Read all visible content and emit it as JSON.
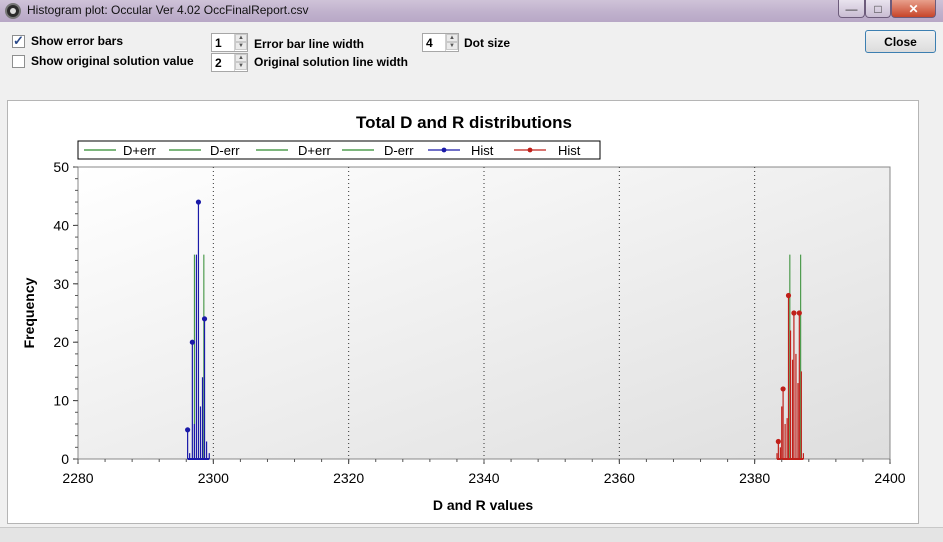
{
  "window": {
    "title": "Histogram plot: Occular Ver 4.02 OccFinalReport.csv",
    "min_glyph": "—",
    "max_glyph": "□",
    "close_glyph": "✕"
  },
  "controls": {
    "show_error_bars": {
      "label": "Show error bars",
      "checked": true
    },
    "show_original": {
      "label": "Show original solution value",
      "checked": false
    },
    "error_bar_line_width": {
      "label": "Error bar line width",
      "value": "1"
    },
    "original_solution_line_width": {
      "label": "Original solution line width",
      "value": "2"
    },
    "dot_size": {
      "label": "Dot size",
      "value": "4"
    },
    "close_label": "Close"
  },
  "chart_data": {
    "type": "line",
    "title": "Total D and R distributions",
    "xlabel": "D and R values",
    "ylabel": "Frequency",
    "xlim": [
      2280,
      2400
    ],
    "ylim": [
      0,
      50
    ],
    "xticks": [
      2280,
      2300,
      2320,
      2340,
      2360,
      2380,
      2400
    ],
    "yticks": [
      0,
      10,
      20,
      30,
      40,
      50
    ],
    "grid": "vertical dotted",
    "legend_position": "top",
    "legend": [
      {
        "label": "D+err",
        "color": "#2e8b2e",
        "marker": false
      },
      {
        "label": "D-err",
        "color": "#2e8b2e",
        "marker": false
      },
      {
        "label": "D+err",
        "color": "#2e8b2e",
        "marker": false
      },
      {
        "label": "D-err",
        "color": "#2e8b2e",
        "marker": false
      },
      {
        "label": "Hist",
        "color": "#1a1aa8",
        "marker": true
      },
      {
        "label": "Hist",
        "color": "#c0201a",
        "marker": true
      }
    ],
    "error_lines": [
      {
        "name": "D+err",
        "x": 2297.2,
        "y": 35,
        "color": "#2e8b2e"
      },
      {
        "name": "D-err",
        "x": 2298.6,
        "y": 35,
        "color": "#2e8b2e"
      },
      {
        "name": "D+err",
        "x": 2385.2,
        "y": 35,
        "color": "#2e8b2e"
      },
      {
        "name": "D-err",
        "x": 2386.8,
        "y": 35,
        "color": "#2e8b2e"
      }
    ],
    "series": [
      {
        "name": "Hist",
        "color": "#1a1aa8",
        "points": [
          {
            "x": 2296.2,
            "y": 5
          },
          {
            "x": 2296.9,
            "y": 20
          },
          {
            "x": 2297.8,
            "y": 44
          },
          {
            "x": 2298.7,
            "y": 24
          }
        ],
        "spikes": [
          {
            "x": 2296.2,
            "y": 5
          },
          {
            "x": 2296.5,
            "y": 1
          },
          {
            "x": 2296.9,
            "y": 20
          },
          {
            "x": 2297.2,
            "y": 6
          },
          {
            "x": 2297.5,
            "y": 35
          },
          {
            "x": 2297.8,
            "y": 44
          },
          {
            "x": 2298.1,
            "y": 9
          },
          {
            "x": 2298.4,
            "y": 14
          },
          {
            "x": 2298.7,
            "y": 24
          },
          {
            "x": 2299.0,
            "y": 3
          },
          {
            "x": 2299.4,
            "y": 1
          }
        ]
      },
      {
        "name": "Hist",
        "color": "#c0201a",
        "points": [
          {
            "x": 2383.5,
            "y": 3
          },
          {
            "x": 2384.2,
            "y": 12
          },
          {
            "x": 2385.0,
            "y": 28
          },
          {
            "x": 2385.8,
            "y": 25
          },
          {
            "x": 2386.6,
            "y": 25
          }
        ],
        "spikes": [
          {
            "x": 2383.3,
            "y": 1
          },
          {
            "x": 2383.5,
            "y": 3
          },
          {
            "x": 2383.8,
            "y": 2
          },
          {
            "x": 2384.0,
            "y": 9
          },
          {
            "x": 2384.2,
            "y": 12
          },
          {
            "x": 2384.5,
            "y": 6
          },
          {
            "x": 2384.8,
            "y": 7
          },
          {
            "x": 2385.0,
            "y": 28
          },
          {
            "x": 2385.3,
            "y": 22
          },
          {
            "x": 2385.6,
            "y": 17
          },
          {
            "x": 2385.8,
            "y": 25
          },
          {
            "x": 2386.1,
            "y": 18
          },
          {
            "x": 2386.4,
            "y": 13
          },
          {
            "x": 2386.6,
            "y": 25
          },
          {
            "x": 2386.9,
            "y": 15
          },
          {
            "x": 2387.2,
            "y": 1
          }
        ]
      }
    ]
  }
}
